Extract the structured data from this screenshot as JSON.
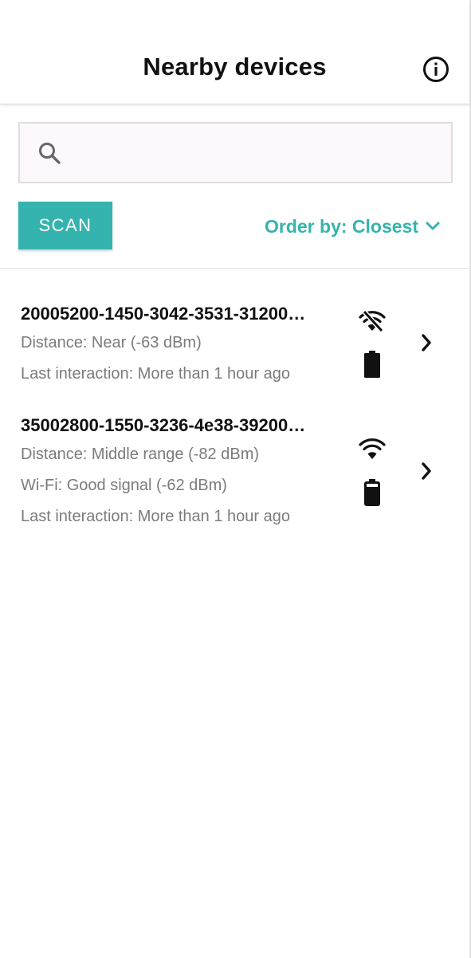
{
  "header": {
    "title": "Nearby devices",
    "info_icon": "info-circle-icon"
  },
  "search": {
    "icon": "search-icon",
    "placeholder": "",
    "value": ""
  },
  "toolbar": {
    "scan_label": "SCAN",
    "order_label": "Order by: Closest",
    "order_icon": "chevron-down-icon",
    "accent_color": "#35b3ae"
  },
  "devices": [
    {
      "name": "20005200-1450-3042-3531-31200…",
      "distance": "Distance: Near (-63 dBm)",
      "last_interaction": "Last interaction: More than 1 hour ago",
      "wifi_icon": "wifi-off-icon",
      "battery_icon": "battery-full-icon",
      "nav_icon": "chevron-right-icon"
    },
    {
      "name": "35002800-1550-3236-4e38-39200…",
      "distance": "Distance: Middle range (-82 dBm)",
      "wifi": "Wi-Fi: Good signal (-62 dBm)",
      "last_interaction": "Last interaction: More than 1 hour ago",
      "wifi_icon": "wifi-icon",
      "battery_icon": "battery-high-icon",
      "nav_icon": "chevron-right-icon"
    }
  ]
}
